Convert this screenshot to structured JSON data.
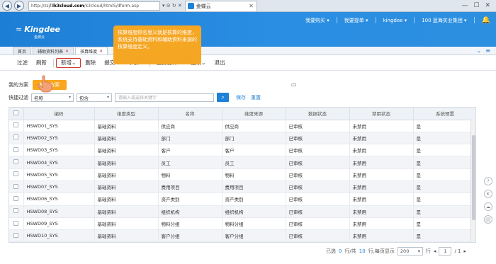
{
  "browser": {
    "url_pre": "http://zsjf.",
    "url_bold": "lk3cloud.com",
    "url_post": "/k3cloud/html5/dform.asp",
    "url_tools": "▾ ⊝ ↻ ✕",
    "tab_title": "金蝶云",
    "tab_close": "✕",
    "back_icon": "◀",
    "forward_icon": "▶",
    "win_controls": [
      "—",
      "☐",
      "✕"
    ]
  },
  "header": {
    "logo_mark": "≈",
    "logo_text": "Kingdee",
    "logo_sub": "金蝶云",
    "menu": [
      "我要购买",
      "我要提单",
      "kingdee",
      "100 蓝海实业集团"
    ],
    "menu_caret": "▾",
    "bell_icon": "🔔"
  },
  "app_tabs": [
    {
      "label": "首页",
      "active": false,
      "closable": false
    },
    {
      "label": "辅助资料列表",
      "active": false,
      "closable": true
    },
    {
      "label": "核算维度",
      "active": true,
      "closable": true
    }
  ],
  "tabs_right_icons": [
    "⌄",
    "≡"
  ],
  "toolbar": [
    "过滤",
    "刷新",
    "新增⌄",
    "删除",
    "提交⌄",
    "审核⌄",
    "业务操作⌄",
    "选项⌄",
    "退出"
  ],
  "tooltip": "核算维度顾名思义就是核算的维度，系统支持基础资料和辅助资料来源的核算维度定义。",
  "scheme": {
    "label": "我的方案",
    "default_btn": "缺省方案"
  },
  "filter": {
    "label": "快捷过滤",
    "field": "名称",
    "operator": "包含",
    "placeholder": "请输入或选择关键字",
    "search_icon": "🔍",
    "save": "保存",
    "reset": "重置"
  },
  "table": {
    "headers": [
      "编码",
      "维度类型",
      "名称",
      "维度来源",
      "数据状态",
      "禁用状态",
      "系统预置"
    ],
    "rows": [
      [
        "HSWD01_SYS",
        "基础资料",
        "供应商",
        "供应商",
        "已审核",
        "未禁用",
        "是"
      ],
      [
        "HSWD02_SYS",
        "基础资料",
        "部门",
        "部门",
        "已审核",
        "未禁用",
        "是"
      ],
      [
        "HSWD03_SYS",
        "基础资料",
        "客户",
        "客户",
        "已审核",
        "未禁用",
        "是"
      ],
      [
        "HSWD04_SYS",
        "基础资料",
        "员工",
        "员工",
        "已审核",
        "未禁用",
        "是"
      ],
      [
        "HSWD05_SYS",
        "基础资料",
        "物料",
        "物料",
        "已审核",
        "未禁用",
        "是"
      ],
      [
        "HSWD07_SYS",
        "基础资料",
        "费用项目",
        "费用项目",
        "已审核",
        "未禁用",
        "是"
      ],
      [
        "HSWD06_SYS",
        "基础资料",
        "资产类别",
        "资产类别",
        "已审核",
        "未禁用",
        "是"
      ],
      [
        "HSWD08_SYS",
        "基础资料",
        "组织机构",
        "组织机构",
        "已审核",
        "未禁用",
        "是"
      ],
      [
        "HSWD09_SYS",
        "基础资料",
        "物料分组",
        "物料分组",
        "已审核",
        "未禁用",
        "是"
      ],
      [
        "HSWD10_SYS",
        "基础资料",
        "客户分组",
        "客户分组",
        "已审核",
        "未禁用",
        "是"
      ]
    ]
  },
  "pager": {
    "selected_pre": "已选",
    "selected_count": "0",
    "selected_post": "行/共",
    "total": "10",
    "total_post": "行,每页显示",
    "page_size": "200",
    "row_label": "行",
    "page_current": "1",
    "page_total": "/ 1",
    "prev": "◂",
    "next": "▸"
  },
  "dock_icons": [
    "?",
    "K",
    "☁",
    "⬜"
  ],
  "colors": {
    "header_blue": "#1d7ed6",
    "tooltip_orange": "#f5a623",
    "link_blue": "#1f80d8",
    "highlight_red": "#d0342c"
  }
}
